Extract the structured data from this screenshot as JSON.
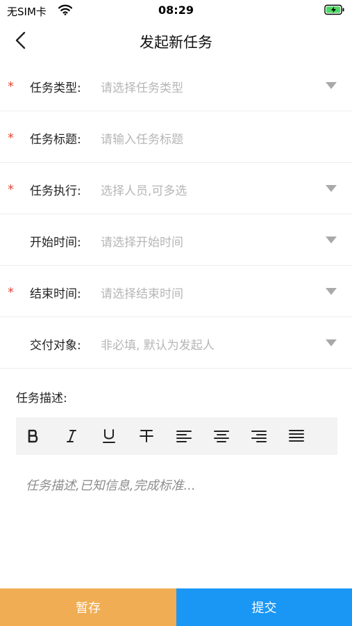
{
  "status_bar": {
    "carrier": "无SIM卡",
    "wifi_icon": "wifi-icon",
    "time": "08:29",
    "battery_icon": "battery-charging-icon"
  },
  "nav": {
    "back_icon": "chevron-left-icon",
    "title": "发起新任务"
  },
  "form": {
    "required_mark": "*",
    "rows": [
      {
        "label": "任务类型:",
        "placeholder": "请选择任务类型",
        "required": true,
        "dropdown": true
      },
      {
        "label": "任务标题:",
        "placeholder": "请输入任务标题",
        "required": true,
        "dropdown": false
      },
      {
        "label": "任务执行:",
        "placeholder": "选择人员,可多选",
        "required": true,
        "dropdown": true
      },
      {
        "label": "开始时间:",
        "placeholder": "请选择开始时间",
        "required": false,
        "dropdown": true
      },
      {
        "label": "结束时间:",
        "placeholder": "请选择结束时间",
        "required": true,
        "dropdown": true
      },
      {
        "label": "交付对象:",
        "placeholder": "非必填, 默认为发起人",
        "required": false,
        "dropdown": true
      }
    ]
  },
  "description": {
    "label": "任务描述:",
    "toolbar": [
      "bold-icon",
      "italic-icon",
      "underline-icon",
      "strikethrough-icon",
      "align-left-icon",
      "align-center-icon",
      "align-right-icon",
      "align-justify-icon"
    ],
    "placeholder": "任务描述,已知信息,完成标准..."
  },
  "actions": {
    "save_label": "暂存",
    "submit_label": "提交"
  },
  "colors": {
    "required": "#e5483b",
    "save_button": "#f0ad53",
    "submit_button": "#1a97f5",
    "placeholder_text": "#b6b6b6",
    "toolbar_bg": "#f3f3f3"
  }
}
